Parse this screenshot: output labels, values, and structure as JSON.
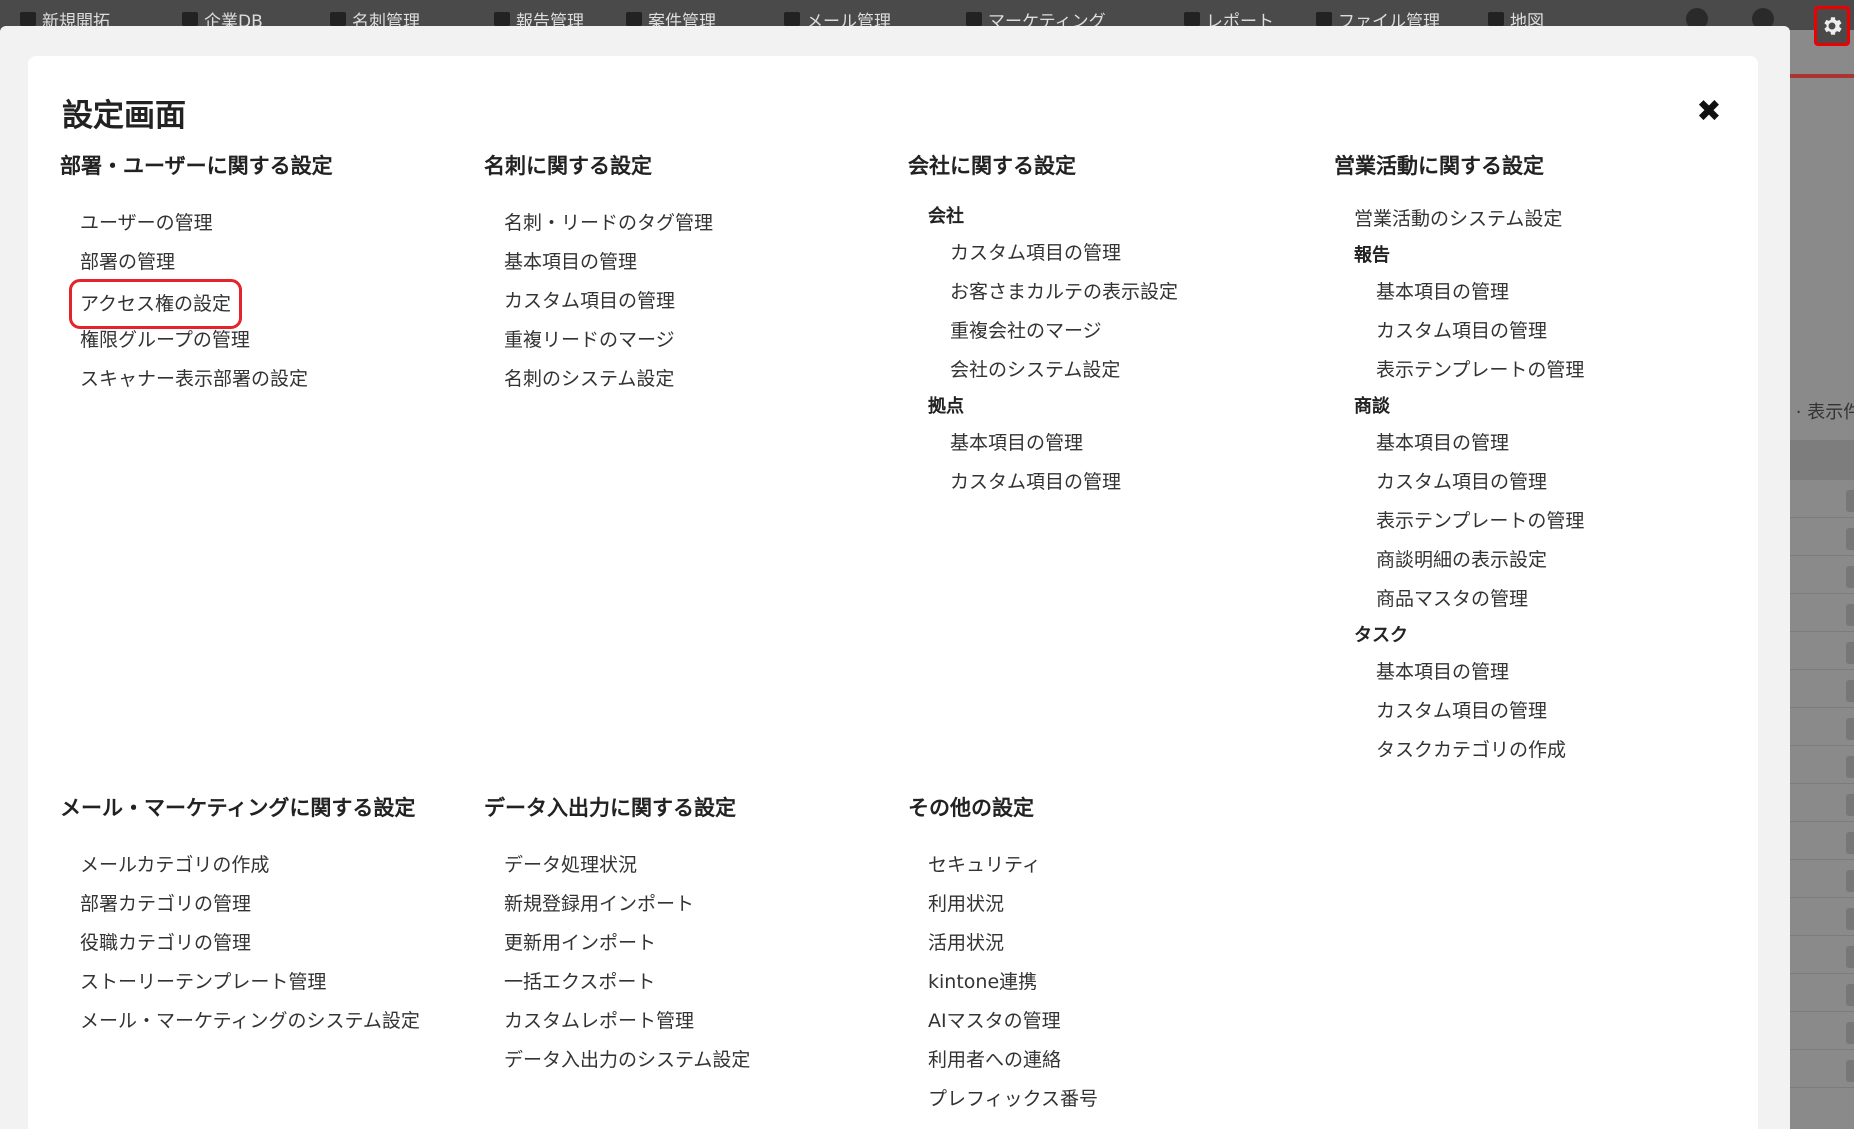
{
  "topnav": {
    "items": [
      "新規開拓",
      "企業DB",
      "名刺管理",
      "報告管理",
      "案件管理",
      "メール管理",
      "マーケティング",
      "レポート",
      "ファイル管理",
      "地図"
    ]
  },
  "background": {
    "partial_text": "表示件"
  },
  "modal": {
    "title": "設定画面",
    "close_icon": "close-icon"
  },
  "sections": {
    "dept_user": {
      "title": "部署・ユーザーに関する設定",
      "links": [
        "ユーザーの管理",
        "部署の管理",
        "アクセス権の設定",
        "権限グループの管理",
        "スキャナー表示部署の設定"
      ]
    },
    "card": {
      "title": "名刺に関する設定",
      "links": [
        "名刺・リードのタグ管理",
        "基本項目の管理",
        "カスタム項目の管理",
        "重複リードのマージ",
        "名刺のシステム設定"
      ]
    },
    "company": {
      "title": "会社に関する設定",
      "groups": [
        {
          "heading": "会社",
          "links": [
            "カスタム項目の管理",
            "お客さまカルテの表示設定",
            "重複会社のマージ",
            "会社のシステム設定"
          ]
        },
        {
          "heading": "拠点",
          "links": [
            "基本項目の管理",
            "カスタム項目の管理"
          ]
        }
      ]
    },
    "sales": {
      "title": "営業活動に関する設定",
      "top_link": "営業活動のシステム設定",
      "groups": [
        {
          "heading": "報告",
          "links": [
            "基本項目の管理",
            "カスタム項目の管理",
            "表示テンプレートの管理"
          ]
        },
        {
          "heading": "商談",
          "links": [
            "基本項目の管理",
            "カスタム項目の管理",
            "表示テンプレートの管理",
            "商談明細の表示設定",
            "商品マスタの管理"
          ]
        },
        {
          "heading": "タスク",
          "links": [
            "基本項目の管理",
            "カスタム項目の管理",
            "タスクカテゴリの作成"
          ]
        }
      ]
    },
    "mail": {
      "title": "メール・マーケティングに関する設定",
      "links": [
        "メールカテゴリの作成",
        "部署カテゴリの管理",
        "役職カテゴリの管理",
        "ストーリーテンプレート管理",
        "メール・マーケティングのシステム設定"
      ]
    },
    "data": {
      "title": "データ入出力に関する設定",
      "links": [
        "データ処理状況",
        "新規登録用インポート",
        "更新用インポート",
        "一括エクスポート",
        "カスタムレポート管理",
        "データ入出力のシステム設定"
      ]
    },
    "other": {
      "title": "その他の設定",
      "links": [
        "セキュリティ",
        "利用状況",
        "活用状況",
        "kintone連携",
        "AIマスタの管理",
        "利用者への連絡",
        "プレフィックス番号"
      ]
    }
  },
  "colors": {
    "highlight": "#e5232b",
    "modal_bg": "#ffffff",
    "overlay": "#8c8c8c"
  }
}
